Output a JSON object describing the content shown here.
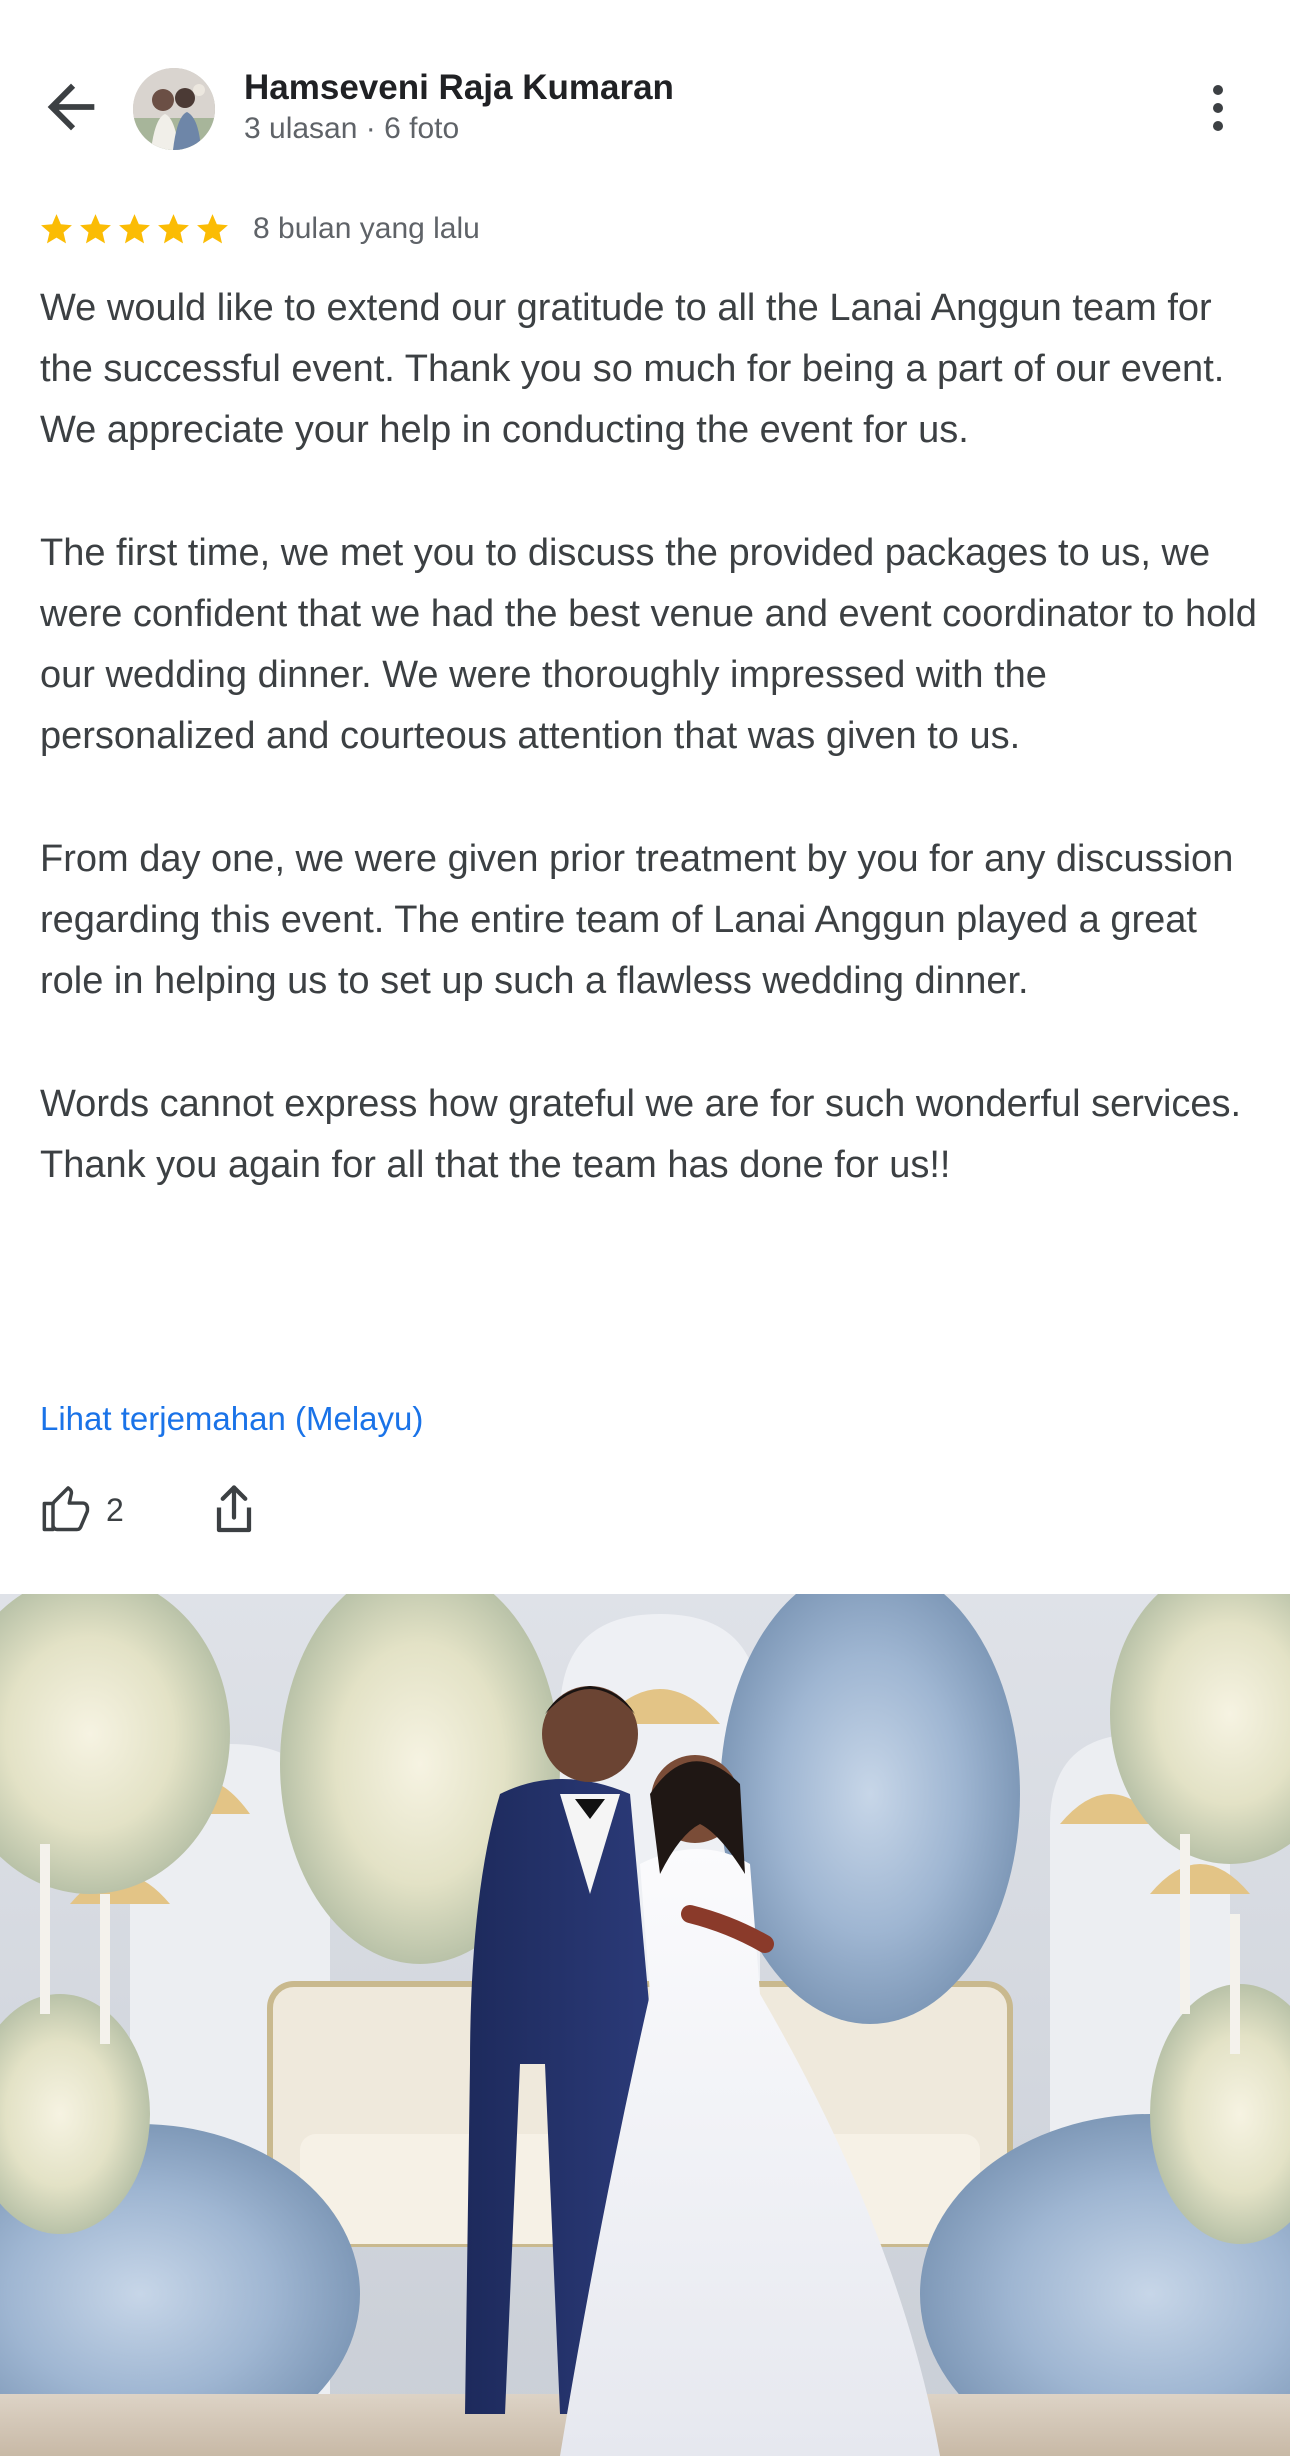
{
  "header": {
    "reviewer_name": "Hamseveni Raja Kumaran",
    "reviewer_meta": "3 ulasan · 6 foto",
    "back_icon": "arrow-back-icon",
    "more_icon": "more-vert-icon"
  },
  "review": {
    "rating": 5,
    "max_rating": 5,
    "time": "8 bulan yang lalu",
    "paragraphs": [
      "We would like to extend our gratitude to all the Lanai Anggun team for the successful event. Thank you so much for being a part of our event. We appreciate your help in conducting the event for us.",
      "The first time, we met you to discuss the provided packages to us, we were confident that we had the best venue and event coordinator to hold our wedding dinner.  We were thoroughly impressed with the personalized and courteous attention that was given to us.",
      "From day one, we were given prior treatment by you for any discussion regarding this event.  The entire team of Lanai Anggun played a great role in helping us to set up such a flawless wedding dinner.",
      "Words cannot express how grateful we are for such wonderful services. Thank you again for all that the team has done for us!!"
    ],
    "translate_link": "Lihat terjemahan (Melayu)"
  },
  "actions": {
    "like_count": "2",
    "like_icon": "thumb-up-icon",
    "share_icon": "share-icon"
  },
  "colors": {
    "star": "#fbbc04",
    "link": "#1a73e8",
    "text": "#3c4043",
    "name": "#202124",
    "meta": "#5f6368"
  }
}
